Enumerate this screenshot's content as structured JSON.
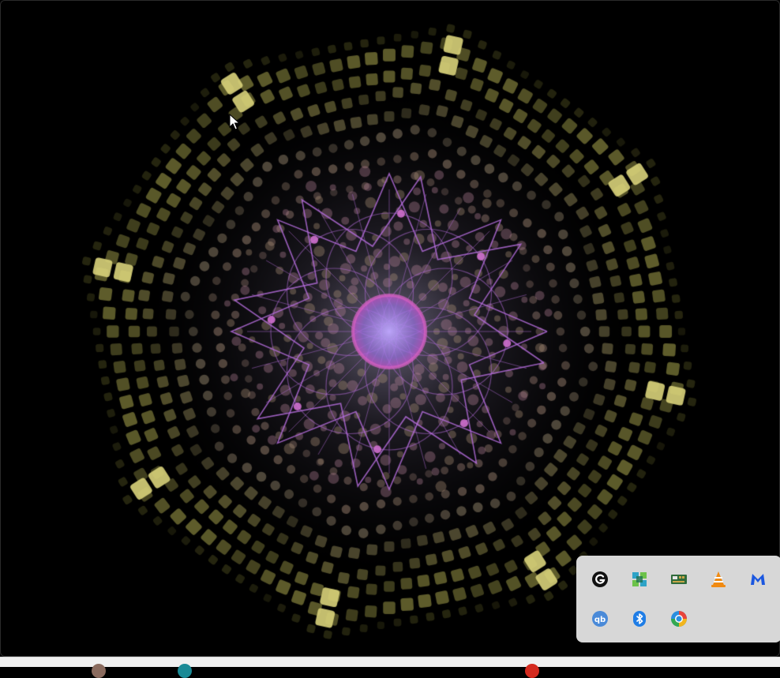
{
  "colors": {
    "background": "#000000",
    "ring_gold": "#c8c46a",
    "ring_dim": "#6b6a2c",
    "petal_violet": "#b26bd8",
    "dot_tan": "#b89a7e",
    "tray_bg": "#d7d7d7",
    "taskbar_bg": "#f0f0f0"
  },
  "tray": {
    "icons": [
      {
        "name": "grammarly-icon"
      },
      {
        "name": "app-grid-icon"
      },
      {
        "name": "network-card-icon"
      },
      {
        "name": "vlc-icon"
      },
      {
        "name": "malwarebytes-icon"
      },
      {
        "name": "qbittorrent-icon"
      },
      {
        "name": "bluetooth-icon"
      },
      {
        "name": "edge-browser-icon"
      }
    ]
  },
  "taskbar": {
    "items": [
      {
        "name": "taskbar-avatar-icon",
        "color": "#8a6b5e"
      },
      {
        "name": "taskbar-teal-app-icon",
        "color": "#1a8a96"
      },
      {
        "name": "taskbar-red-app-icon",
        "color": "#d42a1e"
      }
    ]
  }
}
